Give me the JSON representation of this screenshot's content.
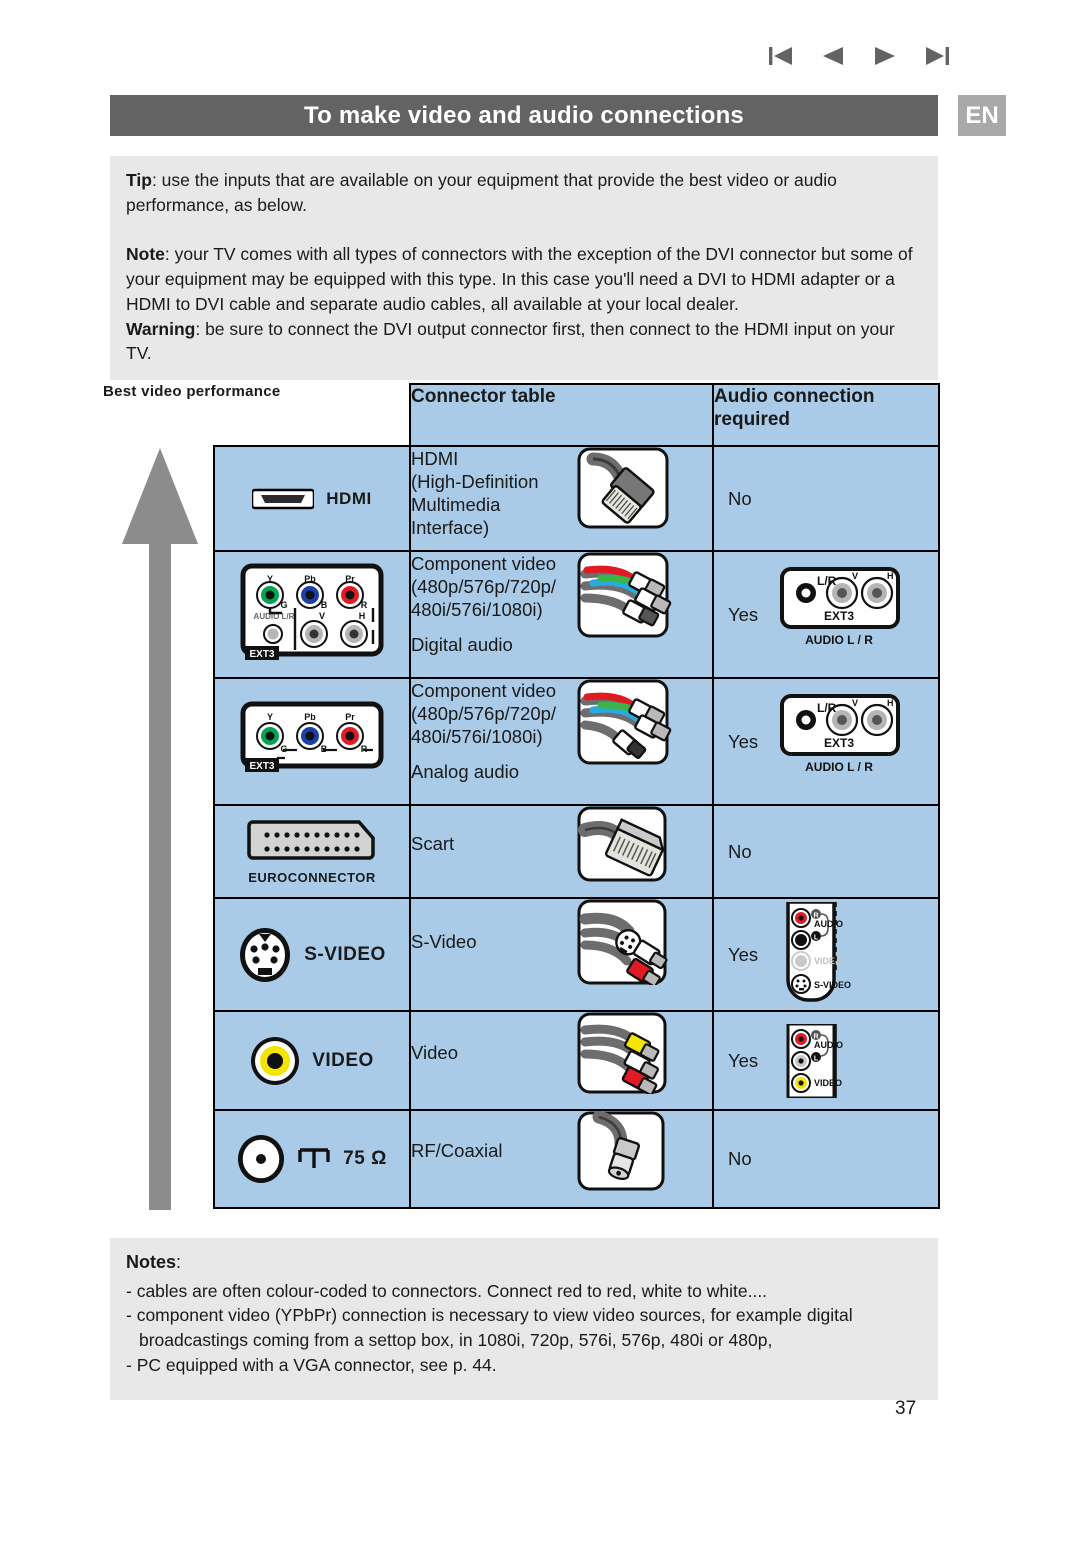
{
  "nav": {
    "first_label": "first-page",
    "prev_label": "previous-page",
    "next_label": "next-page",
    "last_label": "last-page"
  },
  "header": {
    "title": "To make video and audio connections",
    "language_badge": "EN"
  },
  "tip": {
    "label": "Tip",
    "text": ": use the inputs that are available on your equipment that provide the best video or audio performance, as below."
  },
  "note": {
    "note_label": "Note",
    "note_text": ": your TV comes with all types of connectors with the exception of the DVI connector but some of your equipment may be equipped with this type. In this case you'll need a DVI to HDMI adapter or a HDMI to DVI cable and separate audio cables, all available at your local dealer.",
    "warning_label": "Warning",
    "warning_text": ": be sure to connect the DVI output connector first, then connect to the HDMI input on your TV."
  },
  "best_video": {
    "label": "Best video performance",
    "arrow_direction": "up"
  },
  "table": {
    "headers": {
      "connector": "Connector table",
      "audio": "Audio connection required"
    },
    "rows": [
      {
        "icon_name": "hdmi-port-icon",
        "icon_label": "HDMI",
        "description": "HDMI (High-Definition Multimedia Interface)",
        "desc_lines": [
          "HDMI",
          "(High-Definition",
          "Multimedia",
          "Interface)"
        ],
        "cable_icon": "hdmi-cable-icon",
        "audio_required": "No",
        "audio_panel": ""
      },
      {
        "icon_name": "component-video-panel-icon",
        "icon_label": "",
        "panel_labels": [
          "Y",
          "Pb",
          "Pr",
          "G",
          "B",
          "R",
          "AUDIO L/R",
          "V",
          "H",
          "EXT3"
        ],
        "desc_lines": [
          "Component video",
          "(480p/576p/720p/",
          "480i/576i/1080i)",
          "",
          "Digital audio"
        ],
        "cable_icon": "component-cable-icon",
        "audio_required": "Yes",
        "audio_panel": "ext3-audio-panel-icon",
        "audio_panel_labels": [
          "L/R",
          "V",
          "H",
          "EXT3",
          "AUDIO L / R"
        ]
      },
      {
        "icon_name": "component-video-panel-icon",
        "icon_label": "",
        "panel_labels": [
          "Y",
          "Pb",
          "Pr",
          "G",
          "B",
          "R",
          "EXT3"
        ],
        "desc_lines": [
          "Component video",
          "(480p/576p/720p/",
          "480i/576i/1080i)",
          "",
          "Analog audio"
        ],
        "cable_icon": "component-cable-icon",
        "audio_required": "Yes",
        "audio_panel": "ext3-audio-panel-icon",
        "audio_panel_labels": [
          "L/R",
          "V",
          "H",
          "EXT3",
          "AUDIO L / R"
        ]
      },
      {
        "icon_name": "scart-port-icon",
        "icon_label": "EUROCONNECTOR",
        "desc_lines": [
          "Scart"
        ],
        "cable_icon": "scart-cable-icon",
        "audio_required": "No",
        "audio_panel": ""
      },
      {
        "icon_name": "s-video-port-icon",
        "icon_label": "S-VIDEO",
        "desc_lines": [
          "S-Video"
        ],
        "cable_icon": "s-video-cable-icon",
        "audio_required": "Yes",
        "audio_panel": "side-svideo-panel-icon",
        "audio_panel_labels": [
          "R",
          "AUDIO",
          "L",
          "VIDEO",
          "S-VIDEO"
        ]
      },
      {
        "icon_name": "composite-video-port-icon",
        "icon_label": "VIDEO",
        "desc_lines": [
          "Video"
        ],
        "cable_icon": "composite-cable-icon",
        "audio_required": "Yes",
        "audio_panel": "side-video-panel-icon",
        "audio_panel_labels": [
          "R",
          "AUDIO",
          "L",
          "VIDEO"
        ]
      },
      {
        "icon_name": "rf-coaxial-port-icon",
        "icon_label": "75 Ω",
        "desc_lines": [
          "RF/Coaxial"
        ],
        "cable_icon": "coaxial-cable-icon",
        "audio_required": "No",
        "audio_panel": ""
      }
    ]
  },
  "notes": {
    "title": "Notes",
    "colon": ":",
    "items": [
      "- cables are often colour-coded to connectors. Connect red to red, white to white....",
      "- component video (YPbPr) connection is necessary to view video sources, for example digital",
      "broadcastings coming from a settop box, in 1080i, 720p, 576i, 576p, 480i or 480p,",
      "- PC equipped with a VGA connector, see p. 44."
    ]
  },
  "footer": {
    "page_number": "37"
  },
  "colors": {
    "title_bar": "#636363",
    "lang_badge": "#a9a9a9",
    "info_box": "#e8e8e8",
    "table_fill": "#a9cbe8",
    "arrow": "#8c8c8c"
  }
}
